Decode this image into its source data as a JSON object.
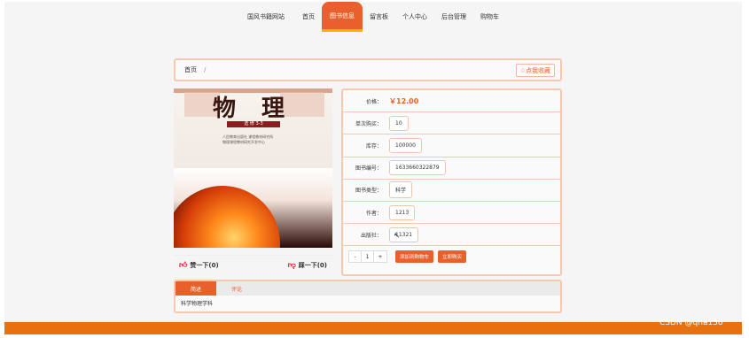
{
  "nav": {
    "brand": "国风书籍网站",
    "items": [
      "首页",
      "图书信息",
      "留言板",
      "个人中心",
      "后台管理",
      "购物车"
    ]
  },
  "breadcrumb": {
    "home": "首页",
    "sep": "/"
  },
  "fav_button": "☆点我收藏",
  "cover": {
    "title": "物 理",
    "subtitle": "选 修 3-3",
    "publisher_line1": "人民教育出版社  课程教材研究所",
    "publisher_line2": "物理课程教材研究开发中心"
  },
  "votes": {
    "up": "赞一下(0)",
    "down": "踩一下(0)"
  },
  "info": {
    "price_label": "价格：",
    "price": "￥12.00",
    "rows": [
      {
        "label": "单次购买：",
        "value": "10"
      },
      {
        "label": "库存：",
        "value": "100000"
      },
      {
        "label": "图书编号：",
        "value": "1633660322879"
      },
      {
        "label": "图书类型：",
        "value": "科学"
      },
      {
        "label": "作者：",
        "value": "1213"
      },
      {
        "label": "出版社：",
        "value": "11321"
      }
    ],
    "qty_minus": "-",
    "qty_value": "1",
    "qty_plus": "+",
    "add_cart": "添加到购物车",
    "buy_now": "立即购买"
  },
  "tabs": {
    "items": [
      "简述",
      "评论"
    ],
    "content": "科学物理学科"
  },
  "watermark": "CSDN @qha138",
  "colors": {
    "accent": "#e8612c",
    "footer": "#e8700f",
    "border": "#f3c9b2"
  }
}
